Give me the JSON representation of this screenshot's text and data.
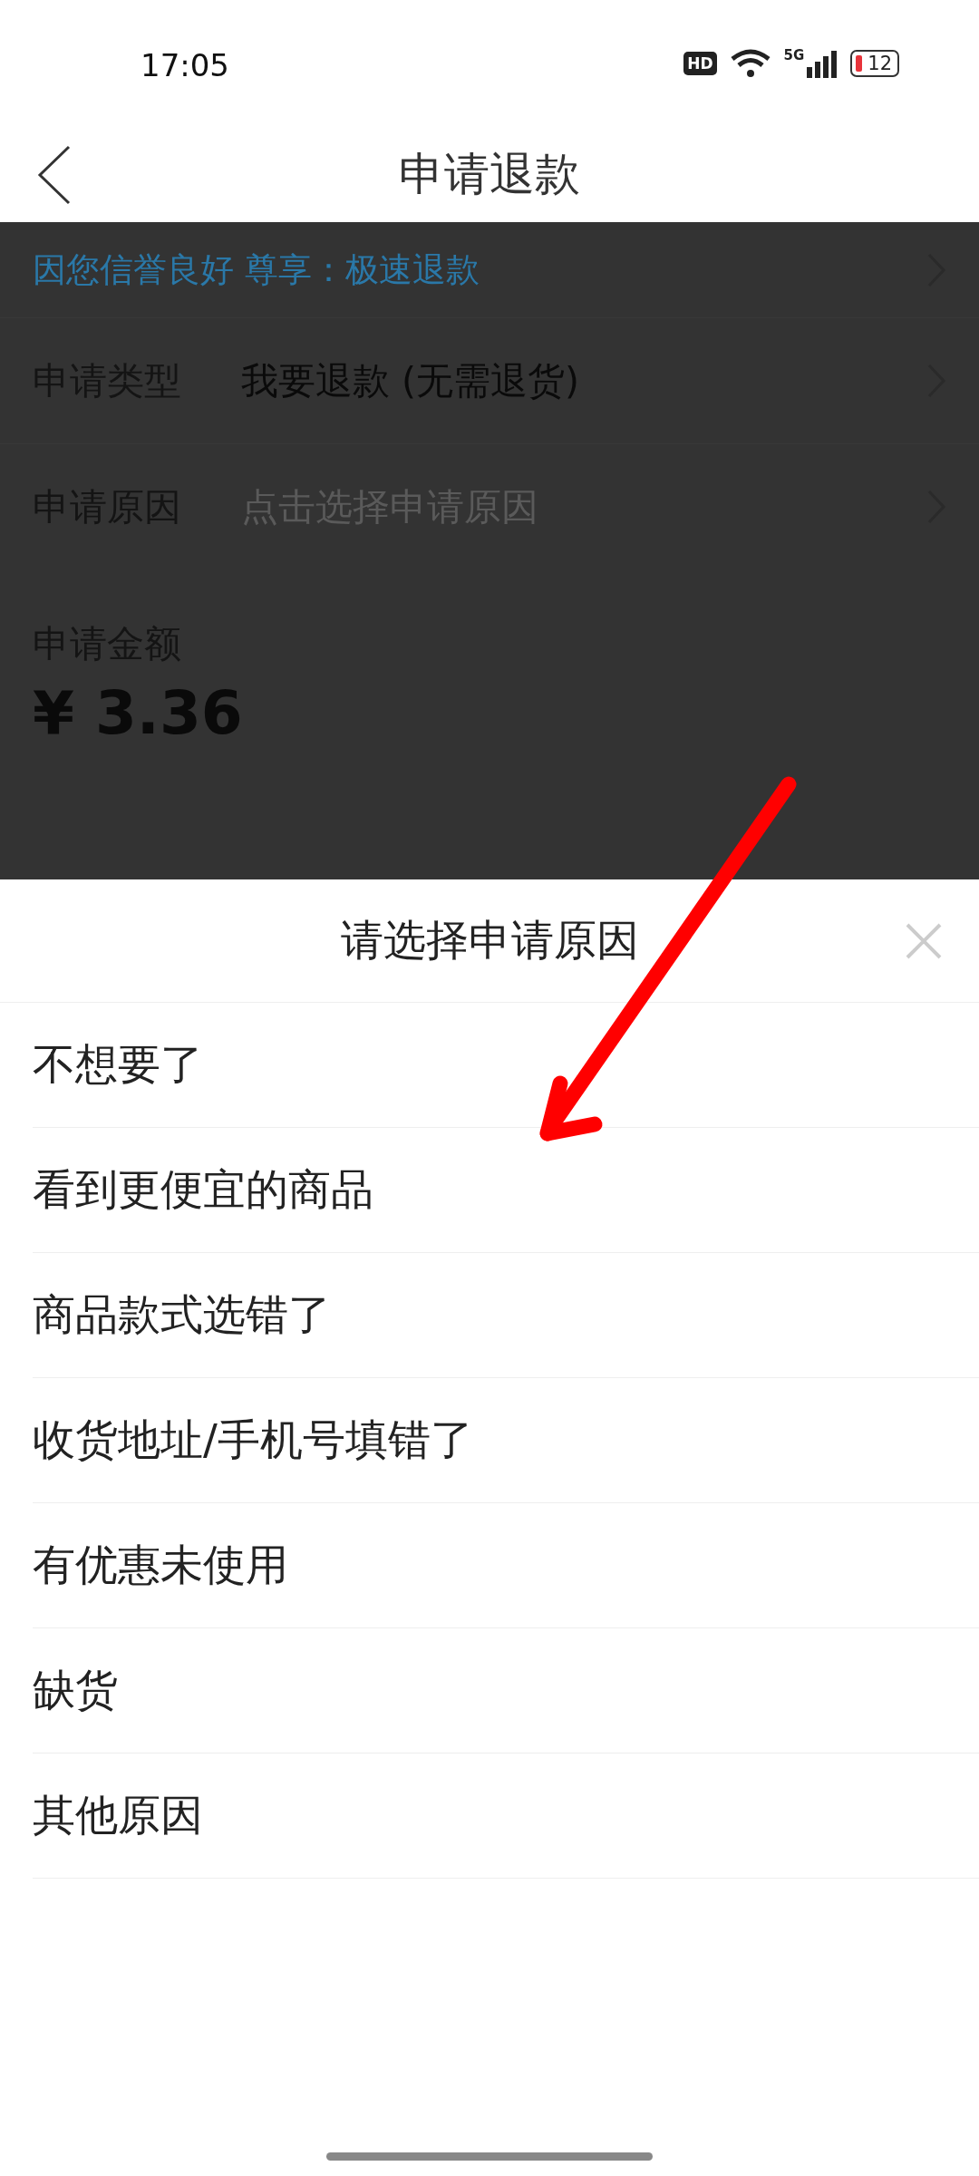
{
  "status_bar": {
    "time": "17:05",
    "hd": "HD",
    "network": "5G",
    "battery": "12"
  },
  "header": {
    "title": "申请退款"
  },
  "form": {
    "banner": "因您信誉良好 尊享：极速退款",
    "rows": [
      {
        "label": "申请类型",
        "value": "我要退款 (无需退货)",
        "placeholder": false
      },
      {
        "label": "申请原因",
        "value": "点击选择申请原因",
        "placeholder": true
      }
    ],
    "amount_label": "申请金额",
    "amount": "¥ 3.36"
  },
  "sheet": {
    "title": "请选择申请原因",
    "options": [
      {
        "label": "不想要了"
      },
      {
        "label": "看到更便宜的商品"
      },
      {
        "label": "商品款式选错了"
      },
      {
        "label": "收货地址/手机号填错了"
      },
      {
        "label": "有优惠未使用"
      },
      {
        "label": "缺货"
      },
      {
        "label": "其他原因"
      }
    ]
  },
  "annotation": {
    "kind": "arrow",
    "color": "#ff0000"
  }
}
